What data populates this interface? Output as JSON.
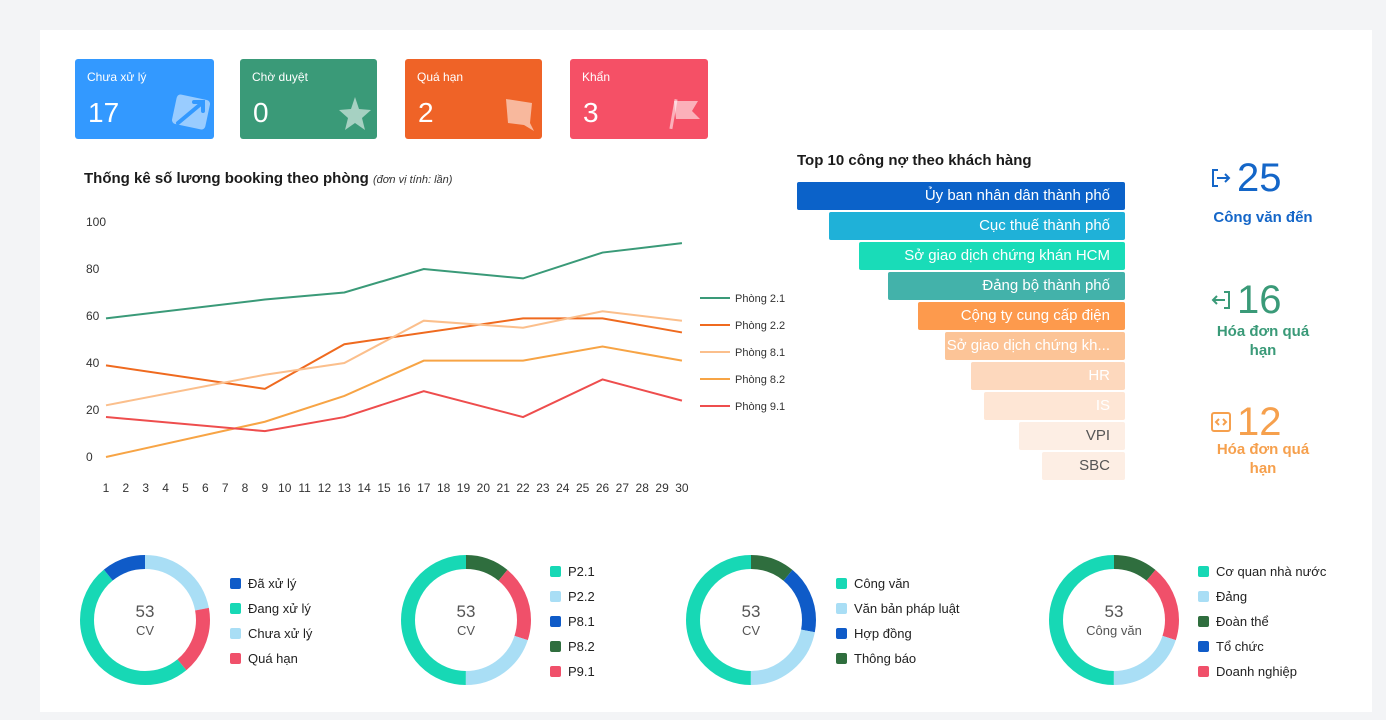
{
  "colors": {
    "blue": "#3399ff",
    "green": "#3a9a78",
    "orange": "#ef6327",
    "red": "#f55066",
    "teal": "#17d8b5",
    "light_blue": "#a9def5",
    "dark_blue": "#0f5bc8",
    "dark_green": "#2f6e3e",
    "pink": "#f0506a"
  },
  "stat_cards": [
    {
      "label": "Chưa xử lý",
      "value": "17",
      "color": "#3399ff",
      "icon": "arrow-chart-icon"
    },
    {
      "label": "Chờ duyệt",
      "value": "0",
      "color": "#3a9a78",
      "icon": "star-icon"
    },
    {
      "label": "Quá hạn",
      "value": "2",
      "color": "#ef6327",
      "icon": "speech-bubble-icon"
    },
    {
      "label": "Khẩn",
      "value": "3",
      "color": "#f55066",
      "icon": "flag-icon"
    }
  ],
  "line_section": {
    "title": "Thống kê số lương booking theo phòng",
    "unit": "(đơn vị tính: lần)"
  },
  "chart_data": {
    "type": "line",
    "x": [
      1,
      2,
      3,
      4,
      5,
      6,
      7,
      8,
      9,
      10,
      11,
      12,
      13,
      14,
      15,
      16,
      17,
      18,
      19,
      20,
      21,
      22,
      23,
      24,
      25,
      26,
      27,
      28,
      29,
      30
    ],
    "ylim": [
      0,
      100
    ],
    "yticks": [
      0,
      20,
      40,
      60,
      80,
      100
    ],
    "grid": false,
    "legend_position": "right",
    "series": [
      {
        "name": "Phòng 2.1",
        "color": "#3a9a78",
        "points": [
          [
            1,
            59
          ],
          [
            9,
            67
          ],
          [
            13,
            70
          ],
          [
            17,
            80
          ],
          [
            22,
            76
          ],
          [
            26,
            87
          ],
          [
            30,
            91
          ]
        ]
      },
      {
        "name": "Phòng 2.2",
        "color": "#ef6a1f",
        "points": [
          [
            1,
            39
          ],
          [
            9,
            29
          ],
          [
            13,
            48
          ],
          [
            22,
            59
          ],
          [
            26,
            59
          ],
          [
            30,
            53
          ]
        ]
      },
      {
        "name": "Phòng 8.1",
        "color": "#fbbf8c",
        "points": [
          [
            1,
            22
          ],
          [
            9,
            35
          ],
          [
            13,
            40
          ],
          [
            17,
            58
          ],
          [
            22,
            55
          ],
          [
            26,
            62
          ],
          [
            30,
            58
          ]
        ]
      },
      {
        "name": "Phòng 8.2",
        "color": "#f7a445",
        "points": [
          [
            1,
            0
          ],
          [
            9,
            15
          ],
          [
            13,
            26
          ],
          [
            17,
            41
          ],
          [
            22,
            41
          ],
          [
            26,
            47
          ],
          [
            30,
            41
          ]
        ]
      },
      {
        "name": "Phòng 9.1",
        "color": "#ee4d4d",
        "points": [
          [
            1,
            17
          ],
          [
            9,
            11
          ],
          [
            13,
            17
          ],
          [
            17,
            28
          ],
          [
            22,
            17
          ],
          [
            26,
            33
          ],
          [
            30,
            24
          ]
        ]
      }
    ]
  },
  "funnel": {
    "title": "Top 10 công nợ theo khách hàng",
    "items": [
      {
        "label": "Ủy ban nhân dân thành phố",
        "color": "#0b62c9",
        "text_color": "#ffffff"
      },
      {
        "label": "Cục thuế thành phố",
        "color": "#1fb1d8",
        "text_color": "#ffffff"
      },
      {
        "label": "Sở giao dịch chứng khán HCM",
        "color": "#19dcb8",
        "text_color": "#ffffff"
      },
      {
        "label": "Đảng bộ thành phố",
        "color": "#43b2aa",
        "text_color": "#ffffff"
      },
      {
        "label": "Cộng ty cung cấp điện",
        "color": "#fd9a4d",
        "text_color": "#ffffff"
      },
      {
        "label": "Sở giao dịch chứng  kh...",
        "color": "#fcc497",
        "text_color": "#ffffff"
      },
      {
        "label": "HR",
        "color": "#fdd8bd",
        "text_color": "#ffffff"
      },
      {
        "label": "IS",
        "color": "#fee6d5",
        "text_color": "#ffffff"
      },
      {
        "label": "VPI",
        "color": "#fdeee4",
        "text_color": "#555555"
      },
      {
        "label": "SBC",
        "color": "#fdeee4",
        "text_color": "#555555"
      }
    ]
  },
  "key_stats": [
    {
      "value": "25",
      "label": "Công văn đến",
      "color": "#1466c8",
      "icon": "incoming-icon"
    },
    {
      "value": "16",
      "label": "Hóa đơn quá hạn",
      "color": "#3a9a78",
      "icon": "outgoing-icon"
    },
    {
      "value": "12",
      "label": "Hóa đơn quá hạn",
      "color": "#f6a04d",
      "icon": "code-doc-icon"
    }
  ],
  "donuts": [
    {
      "total": "53",
      "unit": "CV",
      "segments": [
        {
          "name": "Đã xử lý",
          "color": "#0f5bc8",
          "value": 0.11
        },
        {
          "name": "Đang xử lý",
          "color": "#17d8b5",
          "value": 0.5
        },
        {
          "name": "Chưa xử lý",
          "color": "#a9def5",
          "value": 0.22
        },
        {
          "name": "Quá hạn",
          "color": "#f0506a",
          "value": 0.17
        }
      ],
      "order": [
        2,
        3,
        1,
        0
      ]
    },
    {
      "total": "53",
      "unit": "CV",
      "segments": [
        {
          "name": "P2.1",
          "color": "#17d8b5",
          "value": 0.5
        },
        {
          "name": "P2.2",
          "color": "#a9def5",
          "value": 0.2
        },
        {
          "name": "P8.1",
          "color": "#0f5bc8",
          "value": 0.0
        },
        {
          "name": "P8.2",
          "color": "#2f6e3e",
          "value": 0.11
        },
        {
          "name": "P9.1",
          "color": "#f0506a",
          "value": 0.19
        }
      ],
      "order": [
        3,
        4,
        1,
        0
      ]
    },
    {
      "total": "53",
      "unit": "CV",
      "segments": [
        {
          "name": "Công văn",
          "color": "#17d8b5",
          "value": 0.5
        },
        {
          "name": "Văn bản pháp luật",
          "color": "#a9def5",
          "value": 0.22
        },
        {
          "name": "Hợp đồng",
          "color": "#0f5bc8",
          "value": 0.17
        },
        {
          "name": "Thông báo",
          "color": "#2f6e3e",
          "value": 0.11
        }
      ],
      "order": [
        3,
        2,
        1,
        0
      ]
    },
    {
      "total": "53",
      "unit": "Công văn",
      "segments": [
        {
          "name": "Cơ quan nhà nước",
          "color": "#17d8b5",
          "value": 0.5
        },
        {
          "name": "Đảng",
          "color": "#a9def5",
          "value": 0.2
        },
        {
          "name": "Đoàn thể",
          "color": "#2f6e3e",
          "value": 0.11
        },
        {
          "name": "Tổ chức",
          "color": "#0f5bc8",
          "value": 0.0
        },
        {
          "name": "Doanh nghiệp",
          "color": "#f0506a",
          "value": 0.19
        }
      ],
      "order": [
        2,
        4,
        1,
        0
      ]
    }
  ]
}
